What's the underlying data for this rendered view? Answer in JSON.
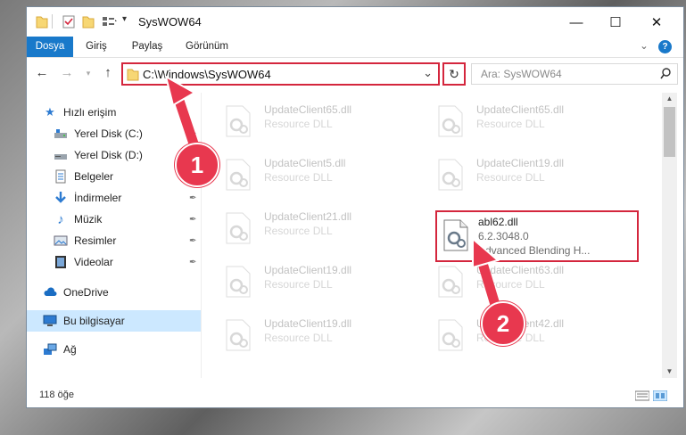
{
  "window": {
    "title": "SysWOW64",
    "controls": {
      "minimize": "—",
      "maximize": "☐",
      "close": "✕"
    }
  },
  "ribbon": {
    "tabs": [
      "Dosya",
      "Giriş",
      "Paylaş",
      "Görünüm"
    ],
    "expand": "⌄",
    "help": "?"
  },
  "address": {
    "back": "←",
    "forward": "→",
    "up": "↑",
    "path": "C:\\Windows\\SysWOW64",
    "dropdown": "⌄",
    "refresh": "↻",
    "search_placeholder": "Ara: SysWOW64",
    "search_icon": "⚲"
  },
  "nav": {
    "items": [
      {
        "label": "Hızlı erişim",
        "icon": "star-icon"
      },
      {
        "label": "Yerel Disk (C:)",
        "icon": "drive-icon",
        "pinned": true
      },
      {
        "label": "Yerel Disk (D:)",
        "icon": "drive-icon",
        "pinned": true
      },
      {
        "label": "Belgeler",
        "icon": "document-icon",
        "pinned": true
      },
      {
        "label": "İndirmeler",
        "icon": "download-icon",
        "pinned": true
      },
      {
        "label": "Müzik",
        "icon": "music-icon",
        "pinned": true
      },
      {
        "label": "Resimler",
        "icon": "picture-icon",
        "pinned": true
      },
      {
        "label": "Videolar",
        "icon": "video-icon",
        "pinned": true
      },
      {
        "label": "OneDrive",
        "icon": "cloud-icon"
      },
      {
        "label": "Bu bilgisayar",
        "icon": "computer-icon",
        "selected": true
      },
      {
        "label": "Ağ",
        "icon": "network-icon"
      }
    ],
    "pin_glyph": "📌"
  },
  "files": [
    {
      "name": "UpdateClient65.dll",
      "type": "Resource DLL"
    },
    {
      "name": "UpdateClient65.dll",
      "type": "Resource DLL"
    },
    {
      "name": "UpdateClient5.dll",
      "type": "Resource DLL"
    },
    {
      "name": "UpdateClient19.dll",
      "type": "Resource DLL"
    },
    {
      "name": "UpdateClient21.dll",
      "type": "Resource DLL"
    },
    {
      "name": "abl62.dll",
      "version": "6.2.3048.0",
      "desc": "Advanced Blending H..."
    },
    {
      "name": "UpdateClient19.dll",
      "type": "Resource DLL"
    },
    {
      "name": "UpdateClient63.dll",
      "type": "Resource DLL"
    },
    {
      "name": "UpdateClient19.dll",
      "type": "Resource DLL"
    },
    {
      "name": "UpdateClient42.dll",
      "type": "Resource DLL"
    }
  ],
  "status": {
    "count": "118 öğe"
  },
  "annotations": {
    "step1": "1",
    "step2": "2"
  },
  "colors": {
    "accent": "#1979ca",
    "highlight": "#d4263d",
    "badge": "#e8384f",
    "selection": "#cce8ff"
  }
}
